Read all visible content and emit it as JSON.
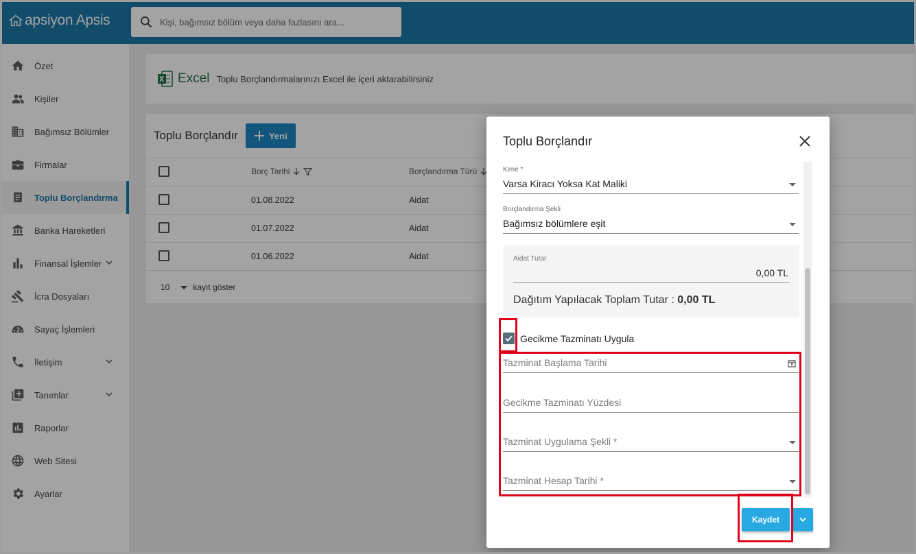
{
  "app": {
    "logo_text": "apsiyon Apsis",
    "search_placeholder": "Kişi, bağımsız bölüm veya daha fazlasını ara..."
  },
  "sidebar": {
    "items": [
      {
        "label": "Özet",
        "icon": "home-icon"
      },
      {
        "label": "Kişiler",
        "icon": "people-icon"
      },
      {
        "label": "Bağımsız Bölümler",
        "icon": "building-icon"
      },
      {
        "label": "Firmalar",
        "icon": "briefcase-icon"
      },
      {
        "label": "Toplu Borçlandırma",
        "icon": "receipt-icon",
        "active": true
      },
      {
        "label": "Banka Hareketleri",
        "icon": "bank-icon"
      },
      {
        "label": "Finansal İşlemler",
        "icon": "bar-chart-icon",
        "expandable": true
      },
      {
        "label": "İcra Dosyaları",
        "icon": "gavel-icon"
      },
      {
        "label": "Sayaç İşlemleri",
        "icon": "meter-icon"
      },
      {
        "label": "İletişim",
        "icon": "phone-icon",
        "expandable": true
      },
      {
        "label": "Tanımlar",
        "icon": "add-box-icon",
        "expandable": true
      },
      {
        "label": "Raporlar",
        "icon": "report-icon"
      },
      {
        "label": "Web Sitesi",
        "icon": "globe-icon"
      },
      {
        "label": "Ayarlar",
        "icon": "gear-icon"
      }
    ]
  },
  "excel_banner": {
    "word": "Excel",
    "text": "Toplu Borçlandırmalarınızı Excel ile içeri aktarabilirsiniz"
  },
  "list": {
    "title": "Toplu Borçlandır",
    "new_label": "Yeni",
    "columns": [
      "Borç Tarihi",
      "Borçlandırma Türü"
    ],
    "rows": [
      {
        "date": "01.08.2022",
        "type": "Aidat"
      },
      {
        "date": "01.07.2022",
        "type": "Aidat"
      },
      {
        "date": "01.06.2022",
        "type": "Aidat"
      }
    ],
    "page_size": "10",
    "page_size_suffix": "kayıt göster"
  },
  "dialog": {
    "title": "Toplu Borçlandır",
    "kime_label": "Kime *",
    "kime_value": "Varsa Kiracı Yoksa Kat Maliki",
    "sekil_label": "Borçlandırma Şekli",
    "sekil_value": "Bağımsız bölümlere eşit",
    "aidat_label": "Aidat Tutar",
    "aidat_value": "0,00 TL",
    "total_label": "Dağıtım Yapılacak Toplam Tutar :",
    "total_value": "0,00 TL",
    "checkbox_label": "Gecikme Tazminatı Uygula",
    "checkbox_checked": true,
    "baslama_placeholder": "Tazminat Başlama Tarihi",
    "yuzde_placeholder": "Gecikme Tazminatı Yüzdesi",
    "uygulama_placeholder": "Tazminat Uygulama Şekli *",
    "hesap_placeholder": "Tazminat Hesap Tarihi *",
    "save_label": "Kaydet"
  },
  "colors": {
    "brand": "#1c79a6",
    "primary_button": "#29a9e1",
    "highlight": "#e0001a"
  }
}
